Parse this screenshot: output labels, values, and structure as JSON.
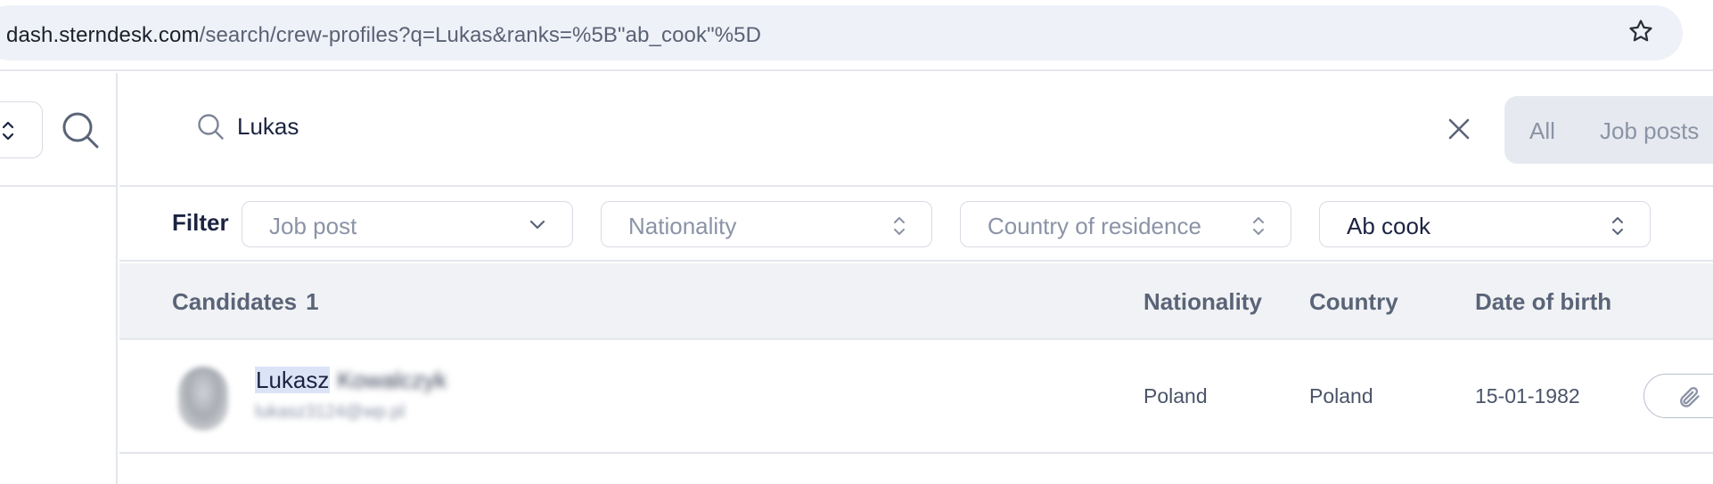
{
  "browser": {
    "url_host": "dash.sterndesk.com",
    "url_path": "/search/crew-profiles?q=Lukas&ranks=%5B\"ab_cook\"%5D",
    "bookmark_icon": "star-icon"
  },
  "search": {
    "query": "Lukas",
    "scope_options": [
      "All",
      "Job posts"
    ]
  },
  "filters": {
    "label": "Filter",
    "job_post": "Job post",
    "nationality": "Nationality",
    "country_of_residence": "Country of residence",
    "rank": "Ab cook"
  },
  "table": {
    "columns": {
      "candidates": "Candidates",
      "candidates_count": "1",
      "nationality": "Nationality",
      "country": "Country",
      "date_of_birth": "Date of birth"
    },
    "rows": [
      {
        "first_name": "Lukasz",
        "last_name_blurred": "Kowalczyk",
        "email_blurred": "lukasz3124@wp.pl",
        "nationality": "Poland",
        "country": "Poland",
        "date_of_birth": "15-01-1982"
      }
    ]
  },
  "colors": {
    "accent_text": "#1b2340",
    "muted_text": "#8b93a6",
    "highlight": "#dbe4f7",
    "header_bg": "#f1f2f5"
  }
}
